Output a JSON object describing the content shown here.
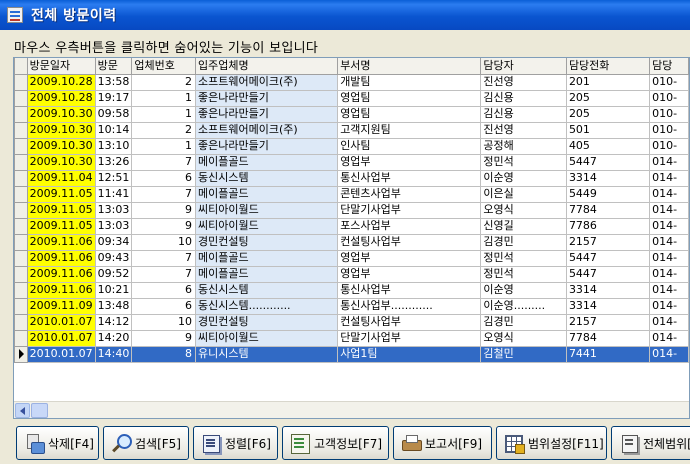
{
  "window": {
    "title": "전체 방문이력"
  },
  "hint": "마우스 우측버튼을 클릭하면 숨어있는 기능이 보입니다",
  "grid": {
    "columns": [
      "방문일자",
      "방문",
      "업체번호",
      "입주업체명",
      "부서명",
      "담당자",
      "담당전화",
      "담당"
    ],
    "rows": [
      [
        "2009.10.28",
        "13:58",
        "2",
        "소프트웨어메이크(주)",
        "개발팀",
        "진선영",
        "201",
        "010-"
      ],
      [
        "2009.10.28",
        "19:17",
        "1",
        "좋은나라만들기",
        "영업팀",
        "김신용",
        "205",
        "010-"
      ],
      [
        "2009.10.30",
        "09:58",
        "1",
        "좋은나라만들기",
        "영업팀",
        "김신용",
        "205",
        "010-"
      ],
      [
        "2009.10.30",
        "10:14",
        "2",
        "소프트웨어메이크(주)",
        "고객지원팀",
        "진선영",
        "501",
        "010-"
      ],
      [
        "2009.10.30",
        "13:10",
        "1",
        "좋은나라만들기",
        "인사팀",
        "공정해",
        "405",
        "010-"
      ],
      [
        "2009.10.30",
        "13:26",
        "7",
        "메이플골드",
        "영업부",
        "정민석",
        "5447",
        "014-"
      ],
      [
        "2009.11.04",
        "12:51",
        "6",
        "동신시스템",
        "통신사업부",
        "이순영",
        "3314",
        "014-"
      ],
      [
        "2009.11.05",
        "11:41",
        "7",
        "메이플골드",
        "콘텐츠사업부",
        "이은실",
        "5449",
        "014-"
      ],
      [
        "2009.11.05",
        "13:03",
        "9",
        "씨티아이월드",
        "단말기사업부",
        "오영식",
        "7784",
        "014-"
      ],
      [
        "2009.11.05",
        "13:03",
        "9",
        "씨티아이월드",
        "포스사업부",
        "신영길",
        "7786",
        "014-"
      ],
      [
        "2009.11.06",
        "09:34",
        "10",
        "경민컨설팅",
        "컨설팅사업부",
        "김경민",
        "2157",
        "014-"
      ],
      [
        "2009.11.06",
        "09:43",
        "7",
        "메이플골드",
        "영업부",
        "정민석",
        "5447",
        "014-"
      ],
      [
        "2009.11.06",
        "09:52",
        "7",
        "메이플골드",
        "영업부",
        "정민석",
        "5447",
        "014-"
      ],
      [
        "2009.11.06",
        "10:21",
        "6",
        "동신시스템",
        "통신사업부",
        "이순영",
        "3314",
        "014-"
      ],
      [
        "2009.11.09",
        "13:48",
        "6",
        "동신시스템............",
        "통신사업부............",
        "이순영.........",
        "3314",
        "014-"
      ],
      [
        "2010.01.07",
        "14:12",
        "10",
        "경민컨설팅",
        "컨설팅사업부",
        "김경민",
        "2157",
        "014-"
      ],
      [
        "2010.01.07",
        "14:20",
        "9",
        "씨티아이월드",
        "단말기사업부",
        "오영식",
        "7784",
        "014-"
      ],
      [
        "2010.01.07",
        "14:40",
        "8",
        "유니시스템",
        "사업1팀",
        "김철민",
        "7441",
        "014-"
      ]
    ],
    "selected_row": 17
  },
  "toolbar": {
    "delete": "삭제[F4]",
    "search": "검색[F5]",
    "sort": "정렬[F6]",
    "customer": "고객정보[F7]",
    "report": "보고서[F9]",
    "range": "범위설정[F11]",
    "all_range": "전체범위["
  },
  "icons": [
    "delete-icon",
    "search-icon",
    "sort-icon",
    "customer-info-icon",
    "report-icon",
    "range-setting-icon",
    "all-range-icon"
  ],
  "colors": {
    "title_bar": "#0a55d0",
    "date_highlight": "#ffff00",
    "company_highlight": "#dde9f7",
    "selection": "#316ac5"
  }
}
